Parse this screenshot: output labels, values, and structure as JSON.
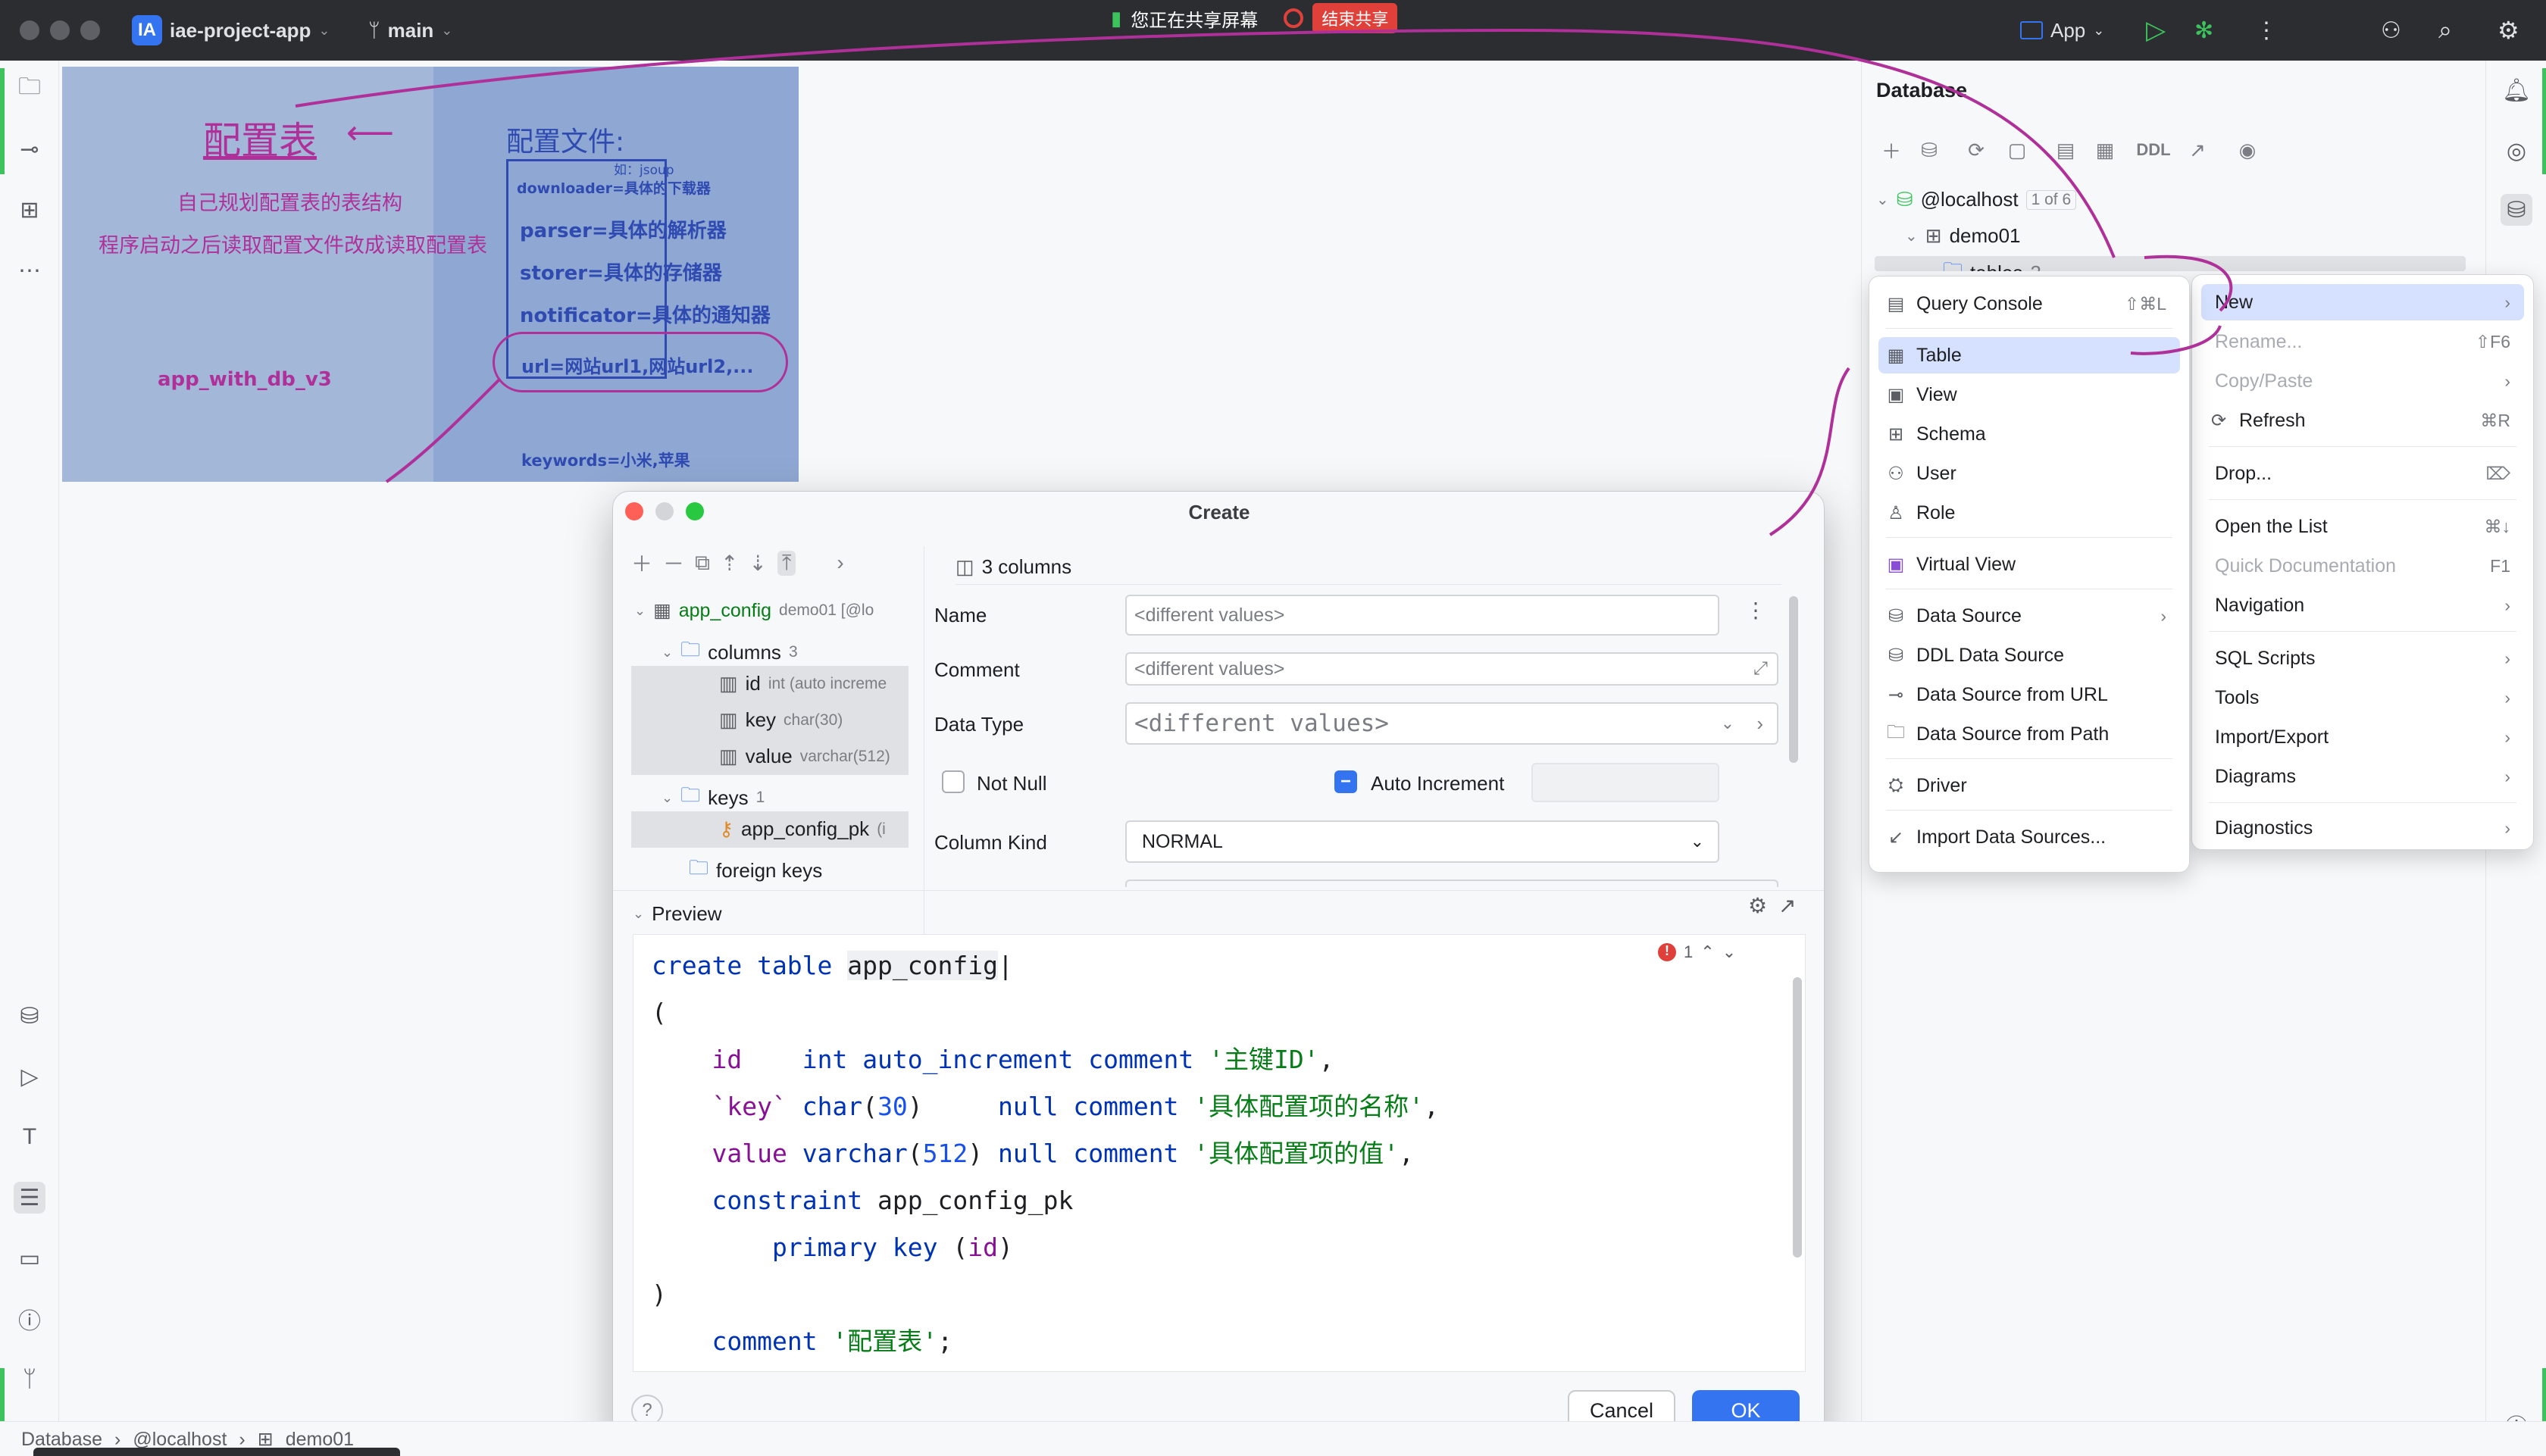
{
  "titlebar": {
    "project_badge": "IA",
    "project_name": "iae-project-app",
    "branch": "main",
    "share_status": "您正在共享屏幕",
    "end_share": "结束共享",
    "run_config": "App"
  },
  "slide": {
    "left_title": "配置表",
    "right_title": "配置文件:",
    "left_line1": "自己规划配置表的表结构",
    "left_line2": "程序启动之后读取配置文件改成读取配置表",
    "left_footer": "app_with_db_v3",
    "note_small": "如：jsoup",
    "right_lines": [
      "downloader=具体的下载器",
      "parser=具体的解析器",
      "storer=具体的存储器",
      "notificator=具体的通知器",
      "url=网站url1,网站url2,..."
    ],
    "keywords": "keywords=小米,苹果"
  },
  "database": {
    "title": "Database",
    "ddl_label": "DDL",
    "tree": {
      "host": "@localhost",
      "host_count": "1 of 6",
      "schema": "demo01",
      "tables_folder": "tables",
      "tables_count": "2"
    }
  },
  "context_menu": {
    "items": [
      {
        "label": "New",
        "shortcut": ""
      },
      {
        "label": "Rename...",
        "shortcut": "⇧F6"
      },
      {
        "label": "Copy/Paste",
        "shortcut": ""
      },
      {
        "label": "Refresh",
        "shortcut": "⌘R"
      },
      {
        "label": "Drop...",
        "shortcut": "⌦"
      },
      {
        "label": "Open the List",
        "shortcut": "⌘↓"
      },
      {
        "label": "Quick Documentation",
        "shortcut": "F1"
      },
      {
        "label": "Navigation",
        "shortcut": ""
      },
      {
        "label": "SQL Scripts",
        "shortcut": ""
      },
      {
        "label": "Tools",
        "shortcut": ""
      },
      {
        "label": "Import/Export",
        "shortcut": ""
      },
      {
        "label": "Diagrams",
        "shortcut": ""
      },
      {
        "label": "Diagnostics",
        "shortcut": ""
      }
    ]
  },
  "new_submenu": {
    "items": [
      {
        "label": "Query Console",
        "shortcut": "⇧⌘L"
      },
      {
        "label": "Table"
      },
      {
        "label": "View"
      },
      {
        "label": "Schema"
      },
      {
        "label": "User"
      },
      {
        "label": "Role"
      },
      {
        "label": "Virtual View"
      },
      {
        "label": "Data Source"
      },
      {
        "label": "DDL Data Source"
      },
      {
        "label": "Data Source from URL"
      },
      {
        "label": "Data Source from Path"
      },
      {
        "label": "Driver"
      },
      {
        "label": "Import Data Sources..."
      }
    ]
  },
  "dialog": {
    "title": "Create",
    "columns_header": "3 columns",
    "tree": {
      "table": "app_config",
      "table_hint": "demo01 [@lo",
      "columns_label": "columns",
      "columns_count": "3",
      "cols": [
        {
          "name": "id",
          "type": "int (auto increme"
        },
        {
          "name": "key",
          "type": "char(30)"
        },
        {
          "name": "value",
          "type": "varchar(512)"
        }
      ],
      "keys_label": "keys",
      "keys_count": "1",
      "pk": "app_config_pk",
      "pk_hint": "(i",
      "foreign_keys": "foreign keys"
    },
    "form": {
      "name_label": "Name",
      "name_value": "<different values>",
      "comment_label": "Comment",
      "comment_value": "<different values>",
      "datatype_label": "Data Type",
      "datatype_value": "<different values>",
      "notnull_label": "Not Null",
      "autoinc_label": "Auto Increment",
      "columnkind_label": "Column Kind",
      "columnkind_value": "NORMAL"
    },
    "preview_label": "Preview",
    "error_count": "1",
    "cancel": "Cancel",
    "ok": "OK",
    "help": "?"
  },
  "statusbar": {
    "crumbs": [
      "Database",
      "@localhost",
      "demo01"
    ]
  }
}
